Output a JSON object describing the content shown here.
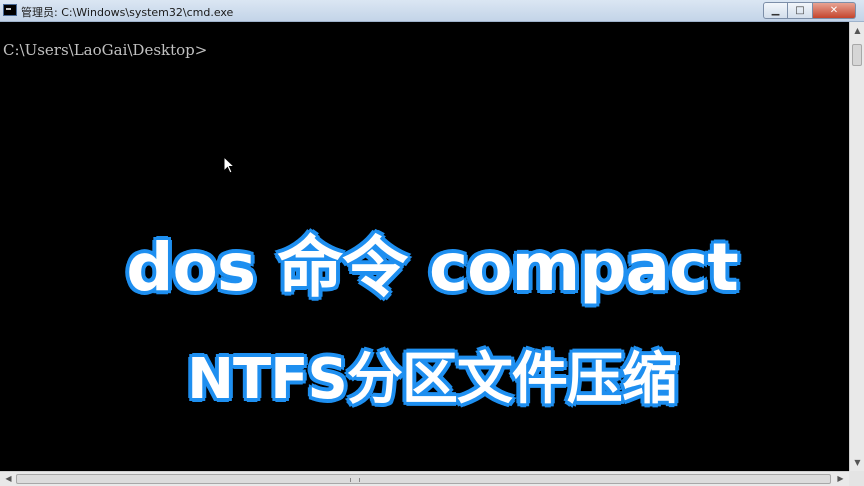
{
  "window": {
    "title": "管理员: C:\\Windows\\system32\\cmd.exe",
    "minimize_glyph": "▁",
    "maximize_glyph": "□",
    "close_glyph": "✕"
  },
  "console": {
    "prompt": "C:\\Users\\LaoGai\\Desktop>"
  },
  "overlay": {
    "line1": "dos 命令 compact",
    "line2": "NTFS分区文件压缩"
  },
  "colors": {
    "overlay_text": "#ffffff",
    "overlay_outline": "#1e8ff0",
    "console_bg": "#000000",
    "console_text": "#c0c0c0"
  },
  "icons": {
    "app": "cmd-icon",
    "cursor": "mouse-pointer-icon"
  }
}
